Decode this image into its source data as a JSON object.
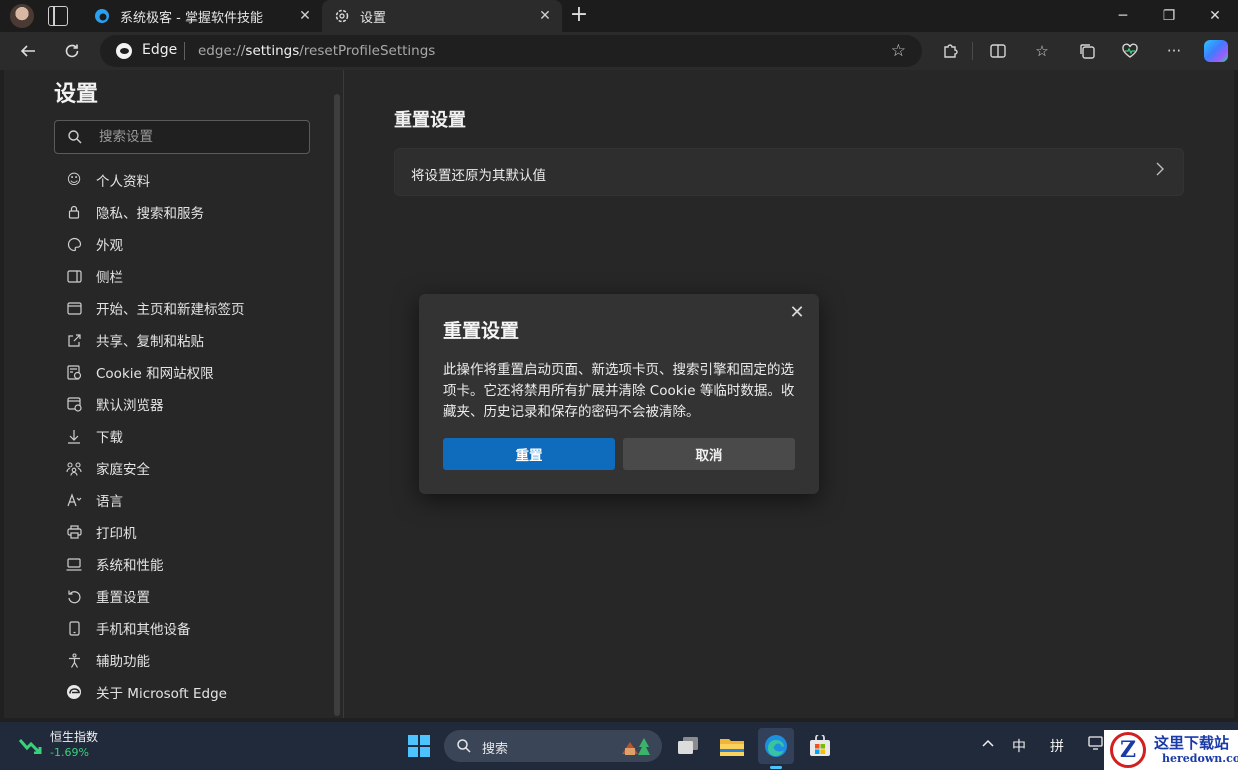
{
  "window": {
    "tabs": [
      {
        "label": "系统极客 - 掌握软件技能",
        "icon": "edge-favicon"
      },
      {
        "label": "设置",
        "icon": "gear-icon"
      }
    ],
    "new_tab_label": "+",
    "controls": {
      "minimize": "─",
      "maximize": "❐",
      "close": "✕"
    }
  },
  "toolbar": {
    "brand": "Edge",
    "url_prefix": "edge://",
    "url_bold": "settings",
    "url_suffix": "/resetProfileSettings"
  },
  "sidebar": {
    "title": "设置",
    "search_placeholder": "搜索设置",
    "items": [
      {
        "label": "个人资料",
        "icon": "profile-icon"
      },
      {
        "label": "隐私、搜索和服务",
        "icon": "lock-icon"
      },
      {
        "label": "外观",
        "icon": "palette-icon"
      },
      {
        "label": "侧栏",
        "icon": "sidebar-icon"
      },
      {
        "label": "开始、主页和新建标签页",
        "icon": "home-icon"
      },
      {
        "label": "共享、复制和粘贴",
        "icon": "share-icon"
      },
      {
        "label": "Cookie 和网站权限",
        "icon": "cookie-icon"
      },
      {
        "label": "默认浏览器",
        "icon": "browser-icon"
      },
      {
        "label": "下载",
        "icon": "download-icon"
      },
      {
        "label": "家庭安全",
        "icon": "family-icon"
      },
      {
        "label": "语言",
        "icon": "language-icon"
      },
      {
        "label": "打印机",
        "icon": "printer-icon"
      },
      {
        "label": "系统和性能",
        "icon": "laptop-icon"
      },
      {
        "label": "重置设置",
        "icon": "reset-icon"
      },
      {
        "label": "手机和其他设备",
        "icon": "phone-icon"
      },
      {
        "label": "辅助功能",
        "icon": "accessibility-icon"
      },
      {
        "label": "关于 Microsoft Edge",
        "icon": "edge-icon"
      }
    ]
  },
  "main": {
    "title": "重置设置",
    "card_label": "将设置还原为其默认值"
  },
  "dialog": {
    "title": "重置设置",
    "body": "此操作将重置启动页面、新选项卡页、搜索引擎和固定的选项卡。它还将禁用所有扩展并清除 Cookie 等临时数据。收藏夹、历史记录和保存的密码不会被清除。",
    "confirm_label": "重置",
    "cancel_label": "取消",
    "primary_color": "#0f6cbd"
  },
  "taskbar": {
    "widget_name": "恒生指数",
    "widget_value": "-1.69%",
    "search_label": "搜索",
    "ime_mode": "中",
    "ime_input": "拼"
  },
  "watermark": {
    "title": "这里下载站",
    "domain": "heredown.com"
  }
}
